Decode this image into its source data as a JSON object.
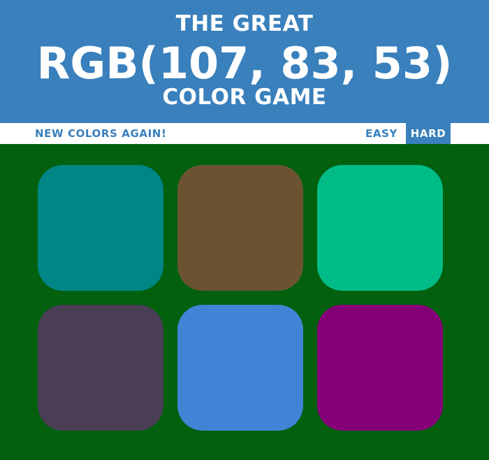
{
  "header": {
    "title_top": "THE GREAT",
    "rgb_display": "RGB(107, 83, 53)",
    "title_bottom": "COLOR GAME",
    "background_color": "#3980bc"
  },
  "navbar": {
    "reset_label": "NEW COLORS AGAIN!",
    "easy_label": "EASY",
    "hard_label": "HARD",
    "selected_mode": "HARD"
  },
  "board": {
    "background_color": "#02600f",
    "squares": [
      {
        "color": "#008785"
      },
      {
        "color": "#6b5332"
      },
      {
        "color": "#00bc86"
      },
      {
        "color": "#4a3e55"
      },
      {
        "color": "#4283d6"
      },
      {
        "color": "#850077"
      }
    ]
  }
}
